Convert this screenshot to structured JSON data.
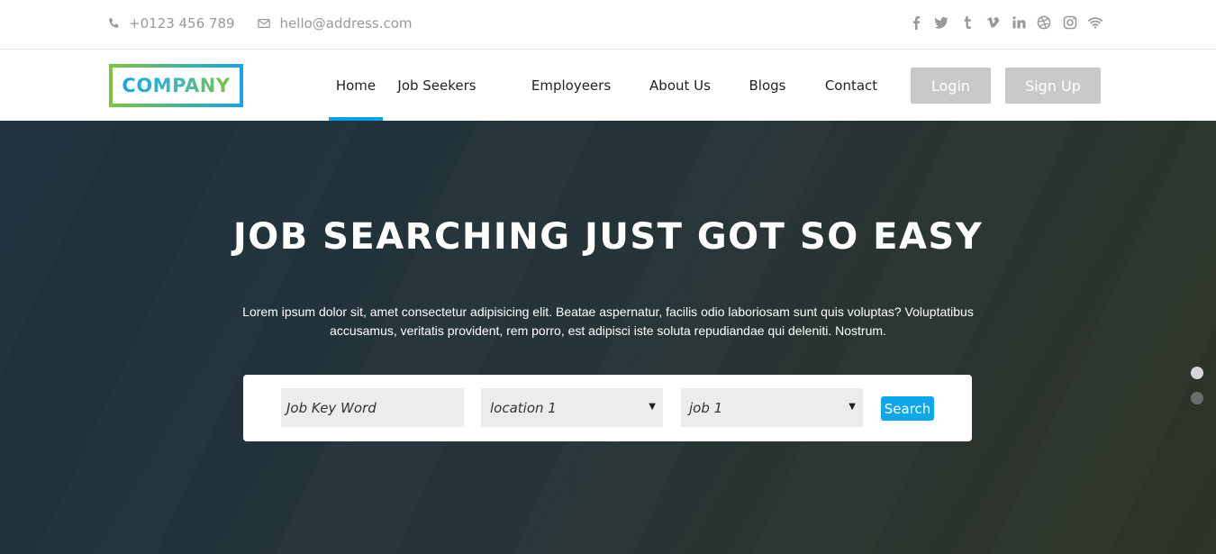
{
  "topbar": {
    "phone": "+0123 456 789",
    "email": "hello@address.com",
    "social_icons": [
      "facebook-icon",
      "twitter-icon",
      "tumblr-icon",
      "vimeo-icon",
      "linkedin-icon",
      "dribbble-icon",
      "instagram-icon",
      "rss-icon"
    ]
  },
  "logo": {
    "text": "COMPANY"
  },
  "nav": {
    "items": [
      {
        "label": "Home",
        "active": true
      },
      {
        "label": "Job Seekers"
      },
      {
        "label": "Employeers"
      },
      {
        "label": "About Us"
      },
      {
        "label": "Blogs"
      },
      {
        "label": "Contact"
      }
    ],
    "login_label": "Login",
    "signup_label": "Sign Up"
  },
  "hero": {
    "title": "JOB SEARCHING JUST GOT SO EASY",
    "description": "Lorem ipsum dolor sit, amet consectetur adipisicing elit. Beatae aspernatur, facilis odio laboriosam sunt quis voluptas? Voluptatibus accusamus, veritatis provident, rem porro, est adipisci iste soluta repudiandae qui deleniti. Nostrum.",
    "search": {
      "keyword_placeholder": "Job Key Word",
      "location_value": "location 1",
      "job_value": "job 1",
      "button_label": "Search"
    },
    "slider_dots": 2
  },
  "colors": {
    "accent": "#11a6e8",
    "logo_green": "#7dc242",
    "auth_button": "#c9c9c9",
    "hero_dark": "#1d313c"
  }
}
